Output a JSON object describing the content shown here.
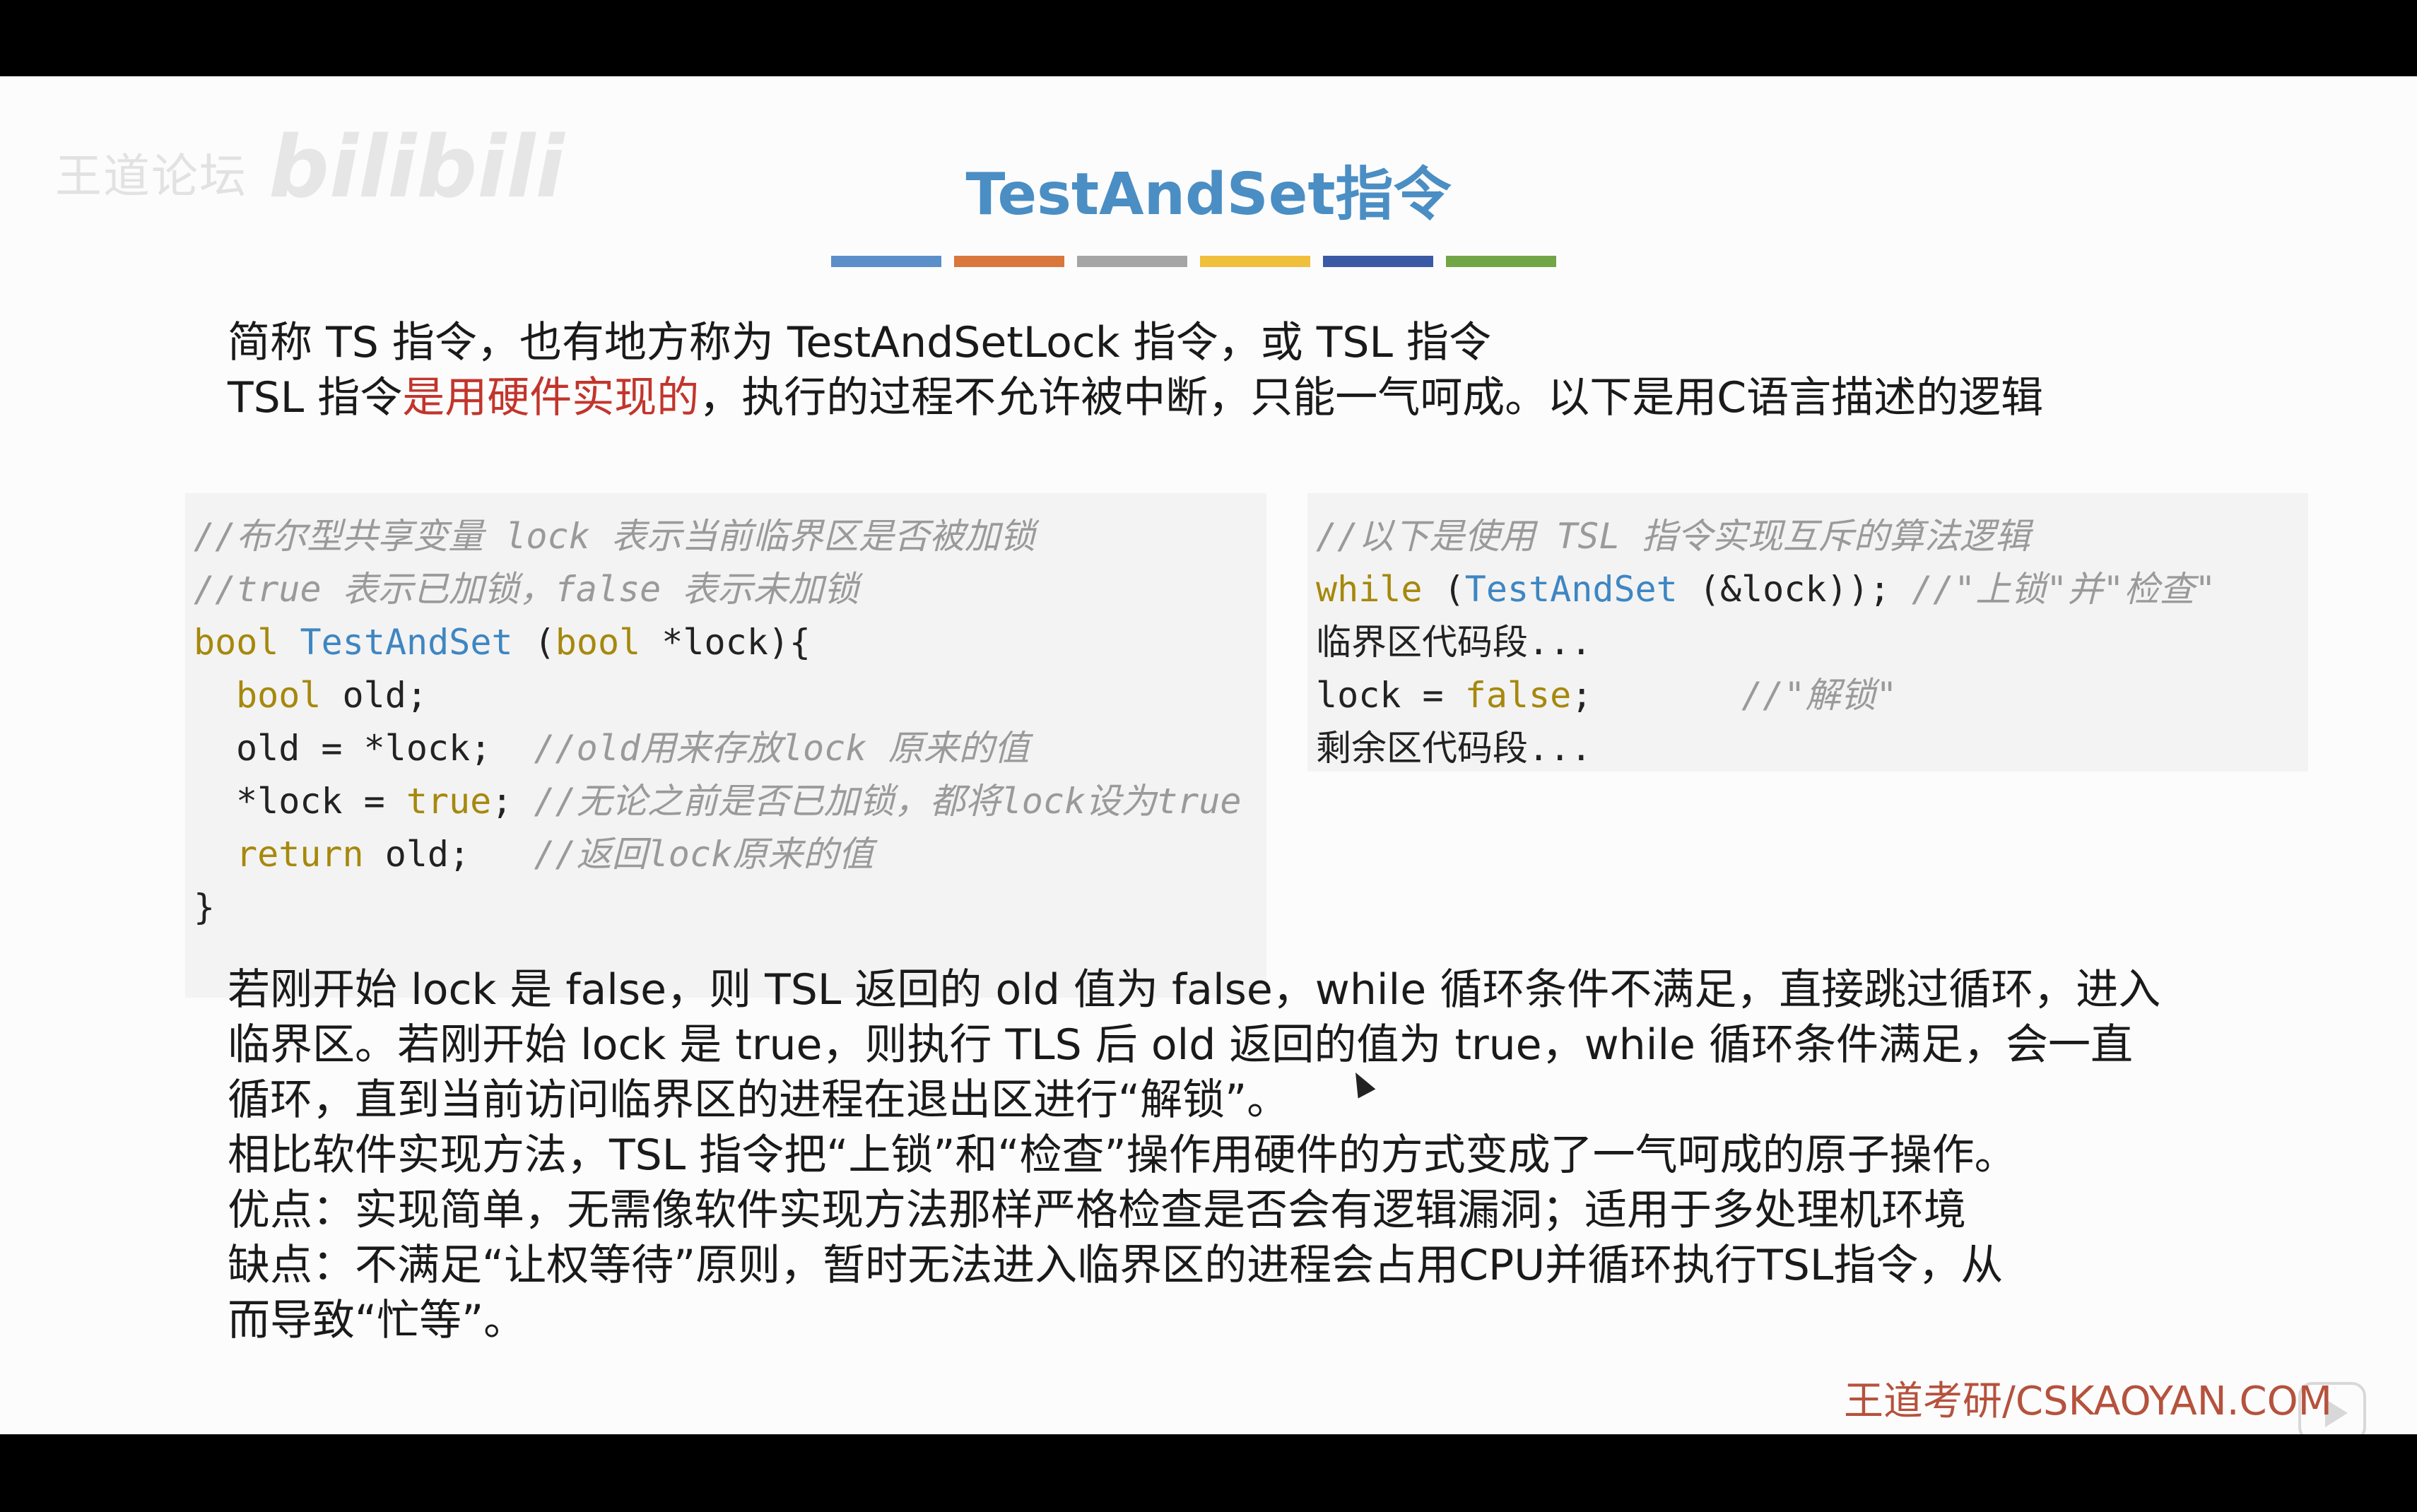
{
  "watermark": {
    "site": "王道论坛",
    "logo": "bilibili"
  },
  "title": "TestAndSet指令",
  "stripe_colors": [
    "#5b8fc9",
    "#d9773c",
    "#a5a5a5",
    "#f0bf3c",
    "#3a5aa5",
    "#72a546"
  ],
  "intro": {
    "line1": "简称 TS 指令，也有地方称为 TestAndSetLock 指令，或 TSL 指令",
    "line2_pre": "TSL 指令",
    "line2_red": "是用硬件实现的",
    "line2_post": "，执行的过程不允许被中断，只能一气呵成。以下是用C语言描述的逻辑"
  },
  "left_code": {
    "c1": "//布尔型共享变量 lock 表示当前临界区是否被加锁",
    "c2": "//true 表示已加锁，false 表示未加锁",
    "l3_kw": "bool",
    "l3_fn": "TestAndSet",
    "l3_open": " (",
    "l3_kw2": "bool",
    "l3_rest": " *lock){",
    "l4_kw": "bool",
    "l4_rest": " old;",
    "l5_code": "old = *lock;  ",
    "l5_cm": "//old用来存放lock 原来的值",
    "l6_code": "*lock = ",
    "l6_kw": "true",
    "l6_semi": "; ",
    "l6_cm": "//无论之前是否已加锁，都将lock设为true",
    "l7_kw": "return",
    "l7_rest": " old;   ",
    "l7_cm": "//返回lock原来的值",
    "l8": "}"
  },
  "right_code": {
    "c1": "//以下是使用 TSL 指令实现互斥的算法逻辑",
    "l2_kw": "while",
    "l2_open": " (",
    "l2_fn": "TestAndSet",
    "l2_rest": " (&lock)); ",
    "l2_cm": "//\"上锁\"并\"检查\"",
    "l3": "临界区代码段...",
    "l4_code": "lock = ",
    "l4_kw": "false",
    "l4_semi": ";       ",
    "l4_cm": "//\"解锁\"",
    "l5": "剩余区代码段..."
  },
  "explain": [
    "若刚开始 lock 是 false，则 TSL 返回的 old 值为 false，while 循环条件不满足，直接跳过循环，进入",
    "临界区。若刚开始 lock 是 true，则执行 TLS 后 old 返回的值为 true，while 循环条件满足，会一直",
    "循环，直到当前访问临界区的进程在退出区进行“解锁”。",
    "相比软件实现方法，TSL 指令把“上锁”和“检查”操作用硬件的方式变成了一气呵成的原子操作。",
    "优点：实现简单，无需像软件实现方法那样严格检查是否会有逻辑漏洞；适用于多处理机环境",
    "缺点：不满足“让权等待”原则，暂时无法进入临界区的进程会占用CPU并循环执行TSL指令，从",
    "而导致“忙等”。"
  ],
  "footer": "王道考研/CSKAOYAN.COM"
}
